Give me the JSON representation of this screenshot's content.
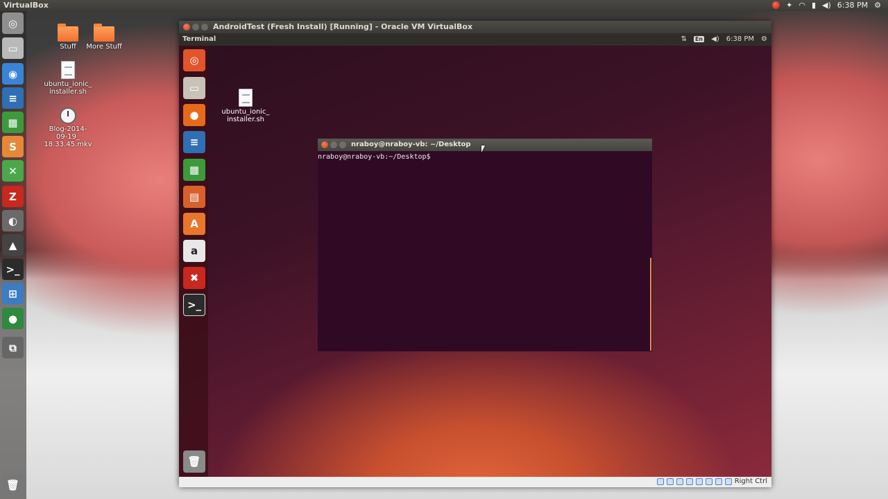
{
  "host": {
    "topbar": {
      "title": "VirtualBox",
      "time": "6:38 PM"
    },
    "launcher": [
      {
        "name": "dash-icon",
        "glyph": "◎",
        "color": "#8f8f8f"
      },
      {
        "name": "files-icon",
        "glyph": "▭",
        "color": "#b9b9b9"
      },
      {
        "name": "chromium-icon",
        "glyph": "◉",
        "color": "#3a84d8"
      },
      {
        "name": "writer-icon",
        "glyph": "≡",
        "color": "#2f6fb3"
      },
      {
        "name": "calc-icon",
        "glyph": "▦",
        "color": "#3c9a3c"
      },
      {
        "name": "sublime-icon",
        "glyph": "S",
        "color": "#e6883a"
      },
      {
        "name": "tools-icon",
        "glyph": "✕",
        "color": "#4aa84a"
      },
      {
        "name": "filezilla-icon",
        "glyph": "Z",
        "color": "#c8281e"
      },
      {
        "name": "camera-icon",
        "glyph": "◐",
        "color": "#6a6a6a"
      },
      {
        "name": "inkscape-icon",
        "glyph": "▲",
        "color": "#444444"
      },
      {
        "name": "terminal-icon",
        "glyph": ">_",
        "color": "#2b2b2b"
      },
      {
        "name": "monitor-icon",
        "glyph": "⊞",
        "color": "#3b7cc2"
      },
      {
        "name": "globe-icon",
        "glyph": "●",
        "color": "#2d8a3e"
      },
      {
        "name": "workspace-icon",
        "glyph": "⧉",
        "color": "#666666"
      },
      {
        "name": "trash-icon",
        "glyph": "🗑",
        "color": "#777777"
      }
    ],
    "desktop": [
      {
        "label": "Stuff",
        "type": "folder"
      },
      {
        "label": "More Stuff",
        "type": "folder"
      },
      {
        "label": "ubuntu_ionic_\ninstaller.sh",
        "type": "doc"
      },
      {
        "label": "Blog-2014-09-19_\n18.33.45.mkv",
        "type": "clock"
      }
    ]
  },
  "vbox": {
    "title": "AndroidTest (Fresh Install) [Running] - Oracle VM VirtualBox",
    "guest_topbar": {
      "app": "Terminal",
      "lang": "En",
      "time": "6:38 PM"
    },
    "guest_launcher": [
      {
        "name": "dash-icon",
        "glyph": "◎",
        "color": "#e2542a"
      },
      {
        "name": "files-icon",
        "glyph": "▭",
        "color": "#c9c2b8"
      },
      {
        "name": "firefox-icon",
        "glyph": "●",
        "color": "#e66a1c"
      },
      {
        "name": "writer-icon",
        "glyph": "≡",
        "color": "#2f6fb3"
      },
      {
        "name": "calc-icon",
        "glyph": "▦",
        "color": "#3c9a3c"
      },
      {
        "name": "impress-icon",
        "glyph": "▤",
        "color": "#d8612b"
      },
      {
        "name": "software-center-icon",
        "glyph": "A",
        "color": "#e8772b"
      },
      {
        "name": "amazon-icon",
        "glyph": "a",
        "color": "#e8e8e8"
      },
      {
        "name": "settings-icon",
        "glyph": "✖",
        "color": "#c8281e"
      },
      {
        "name": "terminal-icon",
        "glyph": ">_",
        "color": "#2b2b2b"
      },
      {
        "name": "trash-icon",
        "glyph": "🗑",
        "color": "#8a8a8a"
      }
    ],
    "guest_desktop": {
      "file_label": "ubuntu_ionic_\ninstaller.sh"
    },
    "terminal": {
      "title": "nraboy@nraboy-vb: ~/Desktop",
      "prompt": "nraboy@nraboy-vb:~/Desktop$"
    },
    "status": {
      "host_key": "Right Ctrl"
    }
  },
  "colors": {
    "terminal_bg": "#300a24",
    "close_red": "#e05a3c",
    "accent_orange": "#f08a4b"
  }
}
